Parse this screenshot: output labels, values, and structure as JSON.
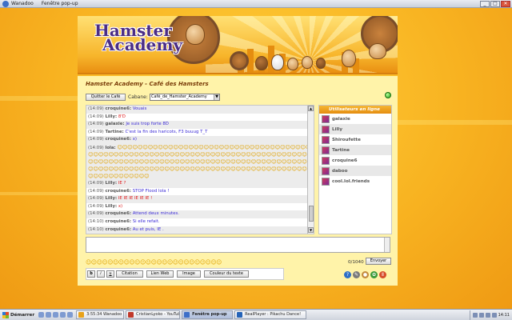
{
  "window": {
    "tabs": [
      "Wanadoo",
      "Fenêtre pop-up"
    ],
    "controls": [
      "_",
      "□",
      "✕"
    ]
  },
  "banner": {
    "logo_line1": "Hamster",
    "logo_line2": "Academy"
  },
  "panel": {
    "title": "Hamster Academy - Café des Hamsters",
    "quit_button": "Quitter le Café",
    "cabane_label": "Cabane:",
    "cabane_selected": "Café_de_Hamster_Academy"
  },
  "chat": {
    "messages": [
      {
        "time": "(14:09)",
        "nick": "croquine6:",
        "text": "Vouais",
        "style": "blue"
      },
      {
        "time": "(14:09)",
        "nick": "Lilly:",
        "text": "8'D",
        "style": "red"
      },
      {
        "time": "(14:09)",
        "nick": "galaxie:",
        "text": "Je suis trop forte 8D",
        "style": "blue"
      },
      {
        "time": "(14:09)",
        "nick": "Tartine:",
        "text": "C'est la fin des haricots, F3 buuug T_T",
        "style": "blue"
      },
      {
        "time": "(14:09)",
        "nick": "croquine6:",
        "text": "x)",
        "style": "blue"
      },
      {
        "time": "(14:09)",
        "nick": "lola:",
        "text": "",
        "style": "smileys"
      },
      {
        "time": "(14:09)",
        "nick": "Lilly:",
        "text": "IE ?",
        "style": "red"
      },
      {
        "time": "(14:09)",
        "nick": "croquine6:",
        "text": "STOP Flood lola !",
        "style": "blue"
      },
      {
        "time": "(14:09)",
        "nick": "Lilly:",
        "text": "IE IE IE IE IE IE !",
        "style": "red"
      },
      {
        "time": "(14:09)",
        "nick": "Lilly:",
        "text": "x)",
        "style": "red"
      },
      {
        "time": "(14:09)",
        "nick": "croquine6:",
        "text": "Attend deux minutes.",
        "style": "blue"
      },
      {
        "time": "(14:10)",
        "nick": "croquine6:",
        "text": "Si elle refait.",
        "style": "blue"
      },
      {
        "time": "(14:10)",
        "nick": "croquine6:",
        "text": "Au et puis, IE .",
        "style": "blue"
      }
    ],
    "smiley_flood": "☺☺☺☺☺☺☺☺☺☺☺☺☺☺☺☺☺☺☺☺☺☺☺☺☺☺☺☺☺☺☺☺☺☺☺☺☺☺☺☺☺☺☺☺☺☺☺☺☺☺☺☺☺☺☺☺☺☺☺☺☺☺☺☺☺☺☺☺☺☺☺☺☺☺☺☺☺☺☺☺☺☺☺☺☺☺☺☺☺☺☺☺☺☺☺☺☺☺☺☺☺☺☺☺☺☺☺☺☺☺☺☺☺☺☺☺☺☺☺☺☺☺☺☺☺☺☺☺☺☺☺☺☺☺☺☺☺☺☺☺☺☺☺☺☺☺☺☺☺☺☺☺☺☺☺☺☺☺☺☺☺☺☺☺☺☺☺☺☺☺☺☺☺☺☺☺☺☺☺☺☺☺"
  },
  "users": {
    "header": "Utilisateurs en ligne",
    "list": [
      {
        "name": "galaxie"
      },
      {
        "name": "Lilly"
      },
      {
        "name": "Shiroufette"
      },
      {
        "name": "Tartine"
      },
      {
        "name": "croquine6"
      },
      {
        "name": "daboo"
      },
      {
        "name": "cool.lol.friends"
      }
    ]
  },
  "composer": {
    "emotes": "☺☺☺☺☺☺☺☺☺☺☺☺☺☺☺☺☺☺☺☺☺☺☺☺☺",
    "counter": "0/1040",
    "send_button": "Envoyer",
    "format_buttons": [
      "b",
      "i",
      "u"
    ],
    "citation_button": "Citation",
    "link_button": "Lien Web",
    "image_button": "Image",
    "color_button": "Couleur du texte"
  },
  "taskbar": {
    "start_label": "Démarrer",
    "tasks": [
      {
        "label": "3:55:34 Wanadoo",
        "color": "#e8a21a"
      },
      {
        "label": "CristianLyoko - YouTube",
        "color": "#c0392b"
      },
      {
        "label": "Fenêtre pop-up",
        "color": "#3d6fc8"
      },
      {
        "label": "RealPlayer : Pikachu Dance!",
        "color": "#2463b8"
      }
    ],
    "clock": "14:11"
  }
}
